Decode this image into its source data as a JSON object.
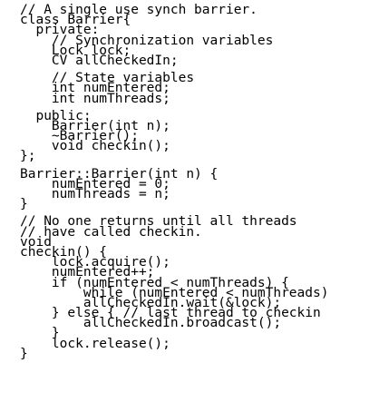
{
  "code": {
    "lines": [
      "// A single use synch barrier.",
      "class Barrier{",
      "  private:",
      "    // Synchronization variables",
      "    Lock lock;",
      "    CV allCheckedIn;",
      "",
      "    // State variables",
      "    int numEntered;",
      "    int numThreads;",
      "",
      "  public:",
      "    Barrier(int n);",
      "    ~Barrier();",
      "    void checkin();",
      "};",
      "",
      "Barrier::Barrier(int n) {",
      "    numEntered = 0;",
      "    numThreads = n;",
      "}",
      "",
      "// No one returns until all threads",
      "// have called checkin.",
      "void",
      "checkin() {",
      "    lock.acquire();",
      "    numEntered++;",
      "    if (numEntered < numThreads) {",
      "        while (numEntered < numThreads)",
      "        allCheckedIn.wait(&lock);",
      "    } else { // last thread to checkin",
      "        allCheckedIn.broadcast();",
      "    }",
      "    lock.release();",
      "}"
    ]
  }
}
